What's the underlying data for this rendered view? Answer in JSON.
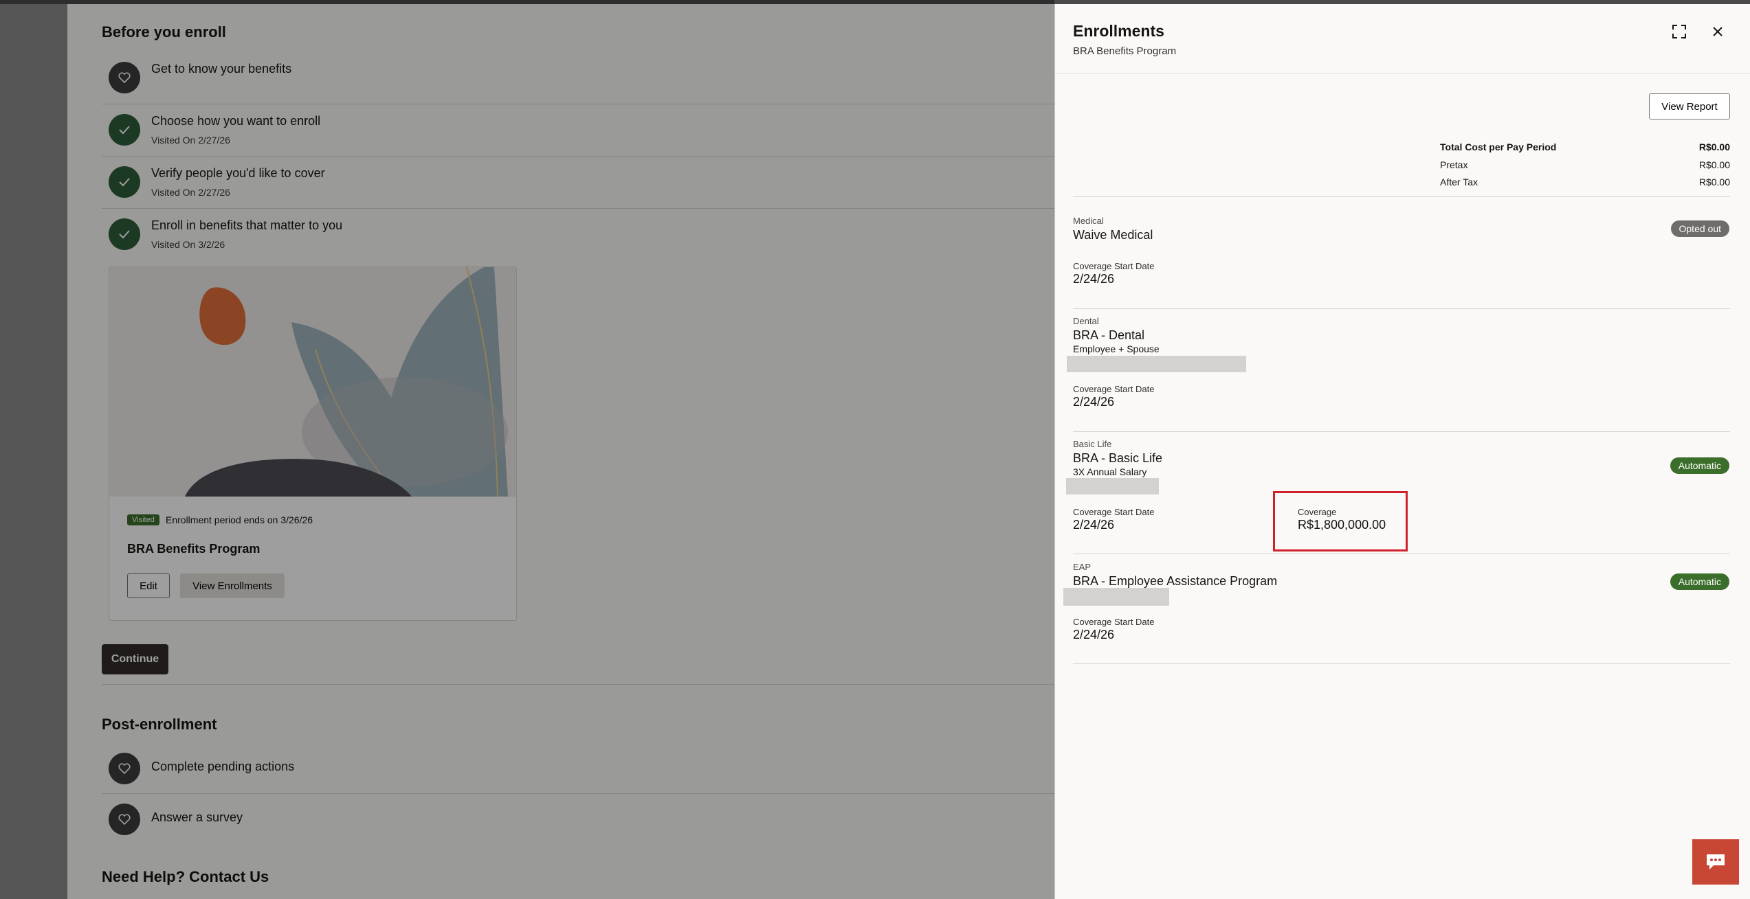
{
  "page": {
    "before_title": "Before you enroll",
    "steps": [
      {
        "title": "Get to know your benefits",
        "sub": "",
        "icon": "heart-icon"
      },
      {
        "title": "Choose how you want to enroll",
        "sub": "Visited On 2/27/26",
        "icon": "check-icon"
      },
      {
        "title": "Verify people you'd like to cover",
        "sub": "Visited On 2/27/26",
        "icon": "check-icon"
      },
      {
        "title": "Enroll in benefits that matter to you",
        "sub": "Visited On 3/2/26",
        "icon": "check-icon"
      }
    ],
    "card": {
      "badge": "Visited",
      "period": "Enrollment period ends on 3/26/26",
      "title": "BRA Benefits Program",
      "edit_label": "Edit",
      "view_label": "View Enrollments"
    },
    "continue_label": "Continue",
    "post_title": "Post-enrollment",
    "post_steps": [
      {
        "title": "Complete pending actions",
        "icon": "heart-icon"
      },
      {
        "title": "Answer a survey",
        "icon": "heart-icon"
      }
    ],
    "help_title": "Need Help? Contact Us"
  },
  "drawer": {
    "title": "Enrollments",
    "subtitle": "BRA Benefits Program",
    "view_report_label": "View Report",
    "totals": {
      "total_label": "Total Cost per Pay Period",
      "total_value": "R$0.00",
      "pretax_label": "Pretax",
      "pretax_value": "R$0.00",
      "aftertax_label": "After Tax",
      "aftertax_value": "R$0.00"
    },
    "coverage_start_label": "Coverage Start Date",
    "sections": [
      {
        "category": "Medical",
        "plan": "Waive Medical",
        "option": "",
        "badge": "Opted out",
        "start_date": "2/24/26"
      },
      {
        "category": "Dental",
        "plan": "BRA - Dental",
        "option": "Employee + Spouse",
        "badge": "",
        "start_date": "2/24/26"
      },
      {
        "category": "Basic Life",
        "plan": "BRA - Basic Life",
        "option": "3X Annual Salary",
        "badge": "Automatic",
        "start_date": "2/24/26",
        "coverage_label": "Coverage",
        "coverage_value": "R$1,800,000.00"
      },
      {
        "category": "EAP",
        "plan": "BRA - Employee Assistance Program",
        "option": "",
        "badge": "Automatic",
        "start_date": "2/24/26"
      }
    ]
  },
  "colors": {
    "accent_green": "#3b6e2a",
    "highlight_red": "#d0202a",
    "chat_button": "#c74634",
    "overlay": "#8f8f8f"
  }
}
